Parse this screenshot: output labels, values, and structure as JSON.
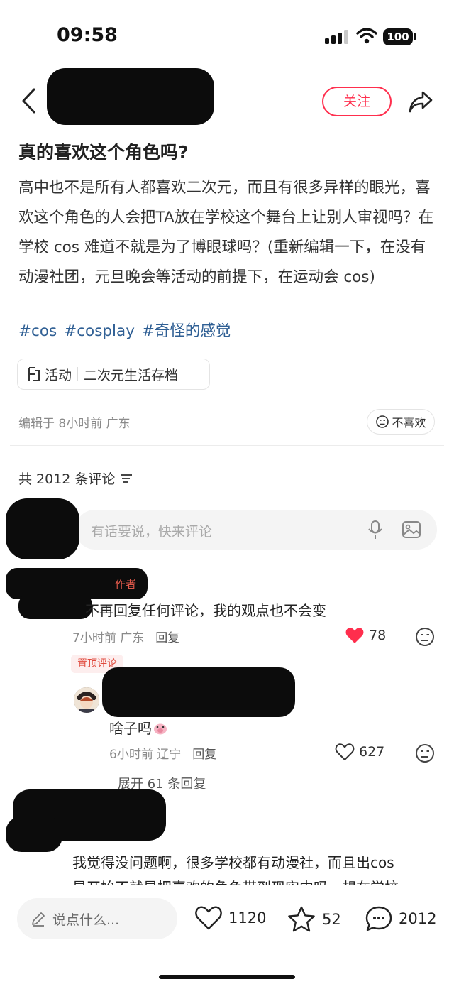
{
  "status_bar": {
    "time": "09:58",
    "battery": "100"
  },
  "nav": {
    "follow_label": "关注"
  },
  "post": {
    "title": "真的喜欢这个角色吗?",
    "body": "高中也不是所有人都喜欢二次元，而且有很多异样的眼光，喜欢这个角色的人会把TA放在学校这个舞台上让别人审视吗？在学校 cos 难道不就是为了博眼球吗？(重新编辑一下，在没有动漫社团，元旦晚会等活动的前提下，在运动会 cos)",
    "tags": [
      "#cos",
      "#cosplay",
      "#奇怪的感觉"
    ],
    "topic_prefix": "活动",
    "topic": "二次元生活存档",
    "edit_meta": "编辑于 8小时前 广东",
    "dislike_label": "不喜欢"
  },
  "comments_header": {
    "count_label": "共 2012 条评论"
  },
  "input": {
    "placeholder": "有话要说，快来评论"
  },
  "comments": [
    {
      "tag": "作者",
      "text": "不再回复任何评论，我的观点也不会变",
      "time_location": "7小时前 广东",
      "reply_label": "回复",
      "likes": "78"
    },
    {
      "pinned_label": "置顶评论",
      "text": "啥子吗",
      "time_location": "6小时前 辽宁",
      "reply_label": "回复",
      "likes": "627",
      "expand_label": "展开 61 条回复"
    },
    {
      "text": "我觉得没问题啊，很多学校都有动漫社，而且出cos",
      "text_line2": "是开始不就是把喜欢的角色带到现实中吗，想在学校"
    }
  ],
  "bottom_bar": {
    "say_placeholder": "说点什么...",
    "likes": "1120",
    "stars": "52",
    "comments": "2012"
  },
  "colors": {
    "accent": "#ff2e4d",
    "tag_blue": "#2f5f94",
    "heart_red": "#ff2e4d"
  }
}
